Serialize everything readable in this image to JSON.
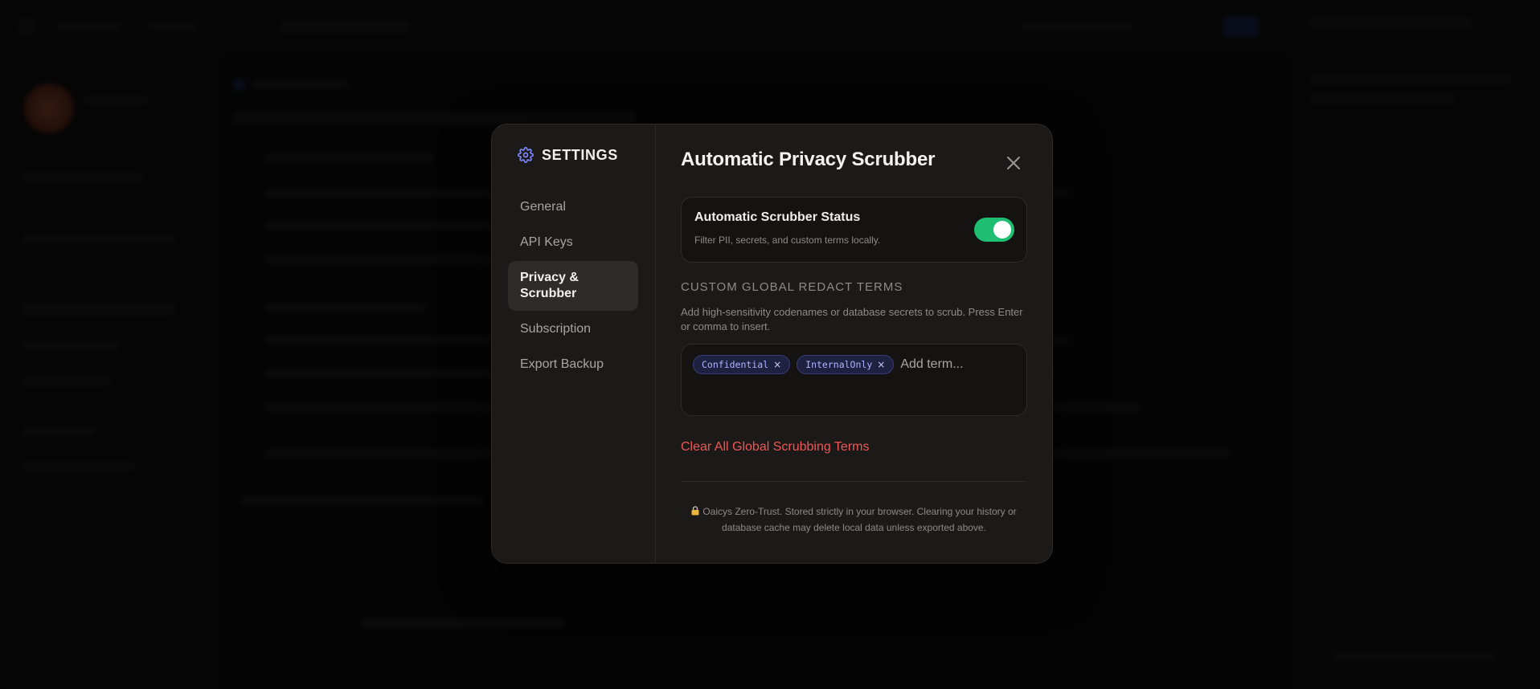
{
  "settings": {
    "title": "SETTINGS",
    "nav": [
      {
        "label": "General"
      },
      {
        "label": "API Keys"
      },
      {
        "label": "Privacy & Scrubber"
      },
      {
        "label": "Subscription"
      },
      {
        "label": "Export Backup"
      }
    ],
    "active_nav": "Privacy & Scrubber"
  },
  "panel": {
    "title": "Automatic Privacy Scrubber",
    "status": {
      "title": "Automatic Scrubber Status",
      "subtitle": "Filter PII, secrets, and custom terms locally.",
      "enabled": true
    },
    "redact": {
      "label": "CUSTOM GLOBAL REDACT TERMS",
      "description": "Add high-sensitivity codenames or database secrets to scrub. Press Enter or comma to insert.",
      "terms": [
        "Confidential",
        "InternalOnly"
      ],
      "remove_symbol": "×",
      "input_placeholder": "Add term..."
    },
    "clear_label": "Clear All Global Scrubbing Terms",
    "footer": "Oaicys Zero-Trust. Stored strictly in your browser. Clearing your history or database cache may delete local data unless exported above."
  },
  "colors": {
    "accent": "#7f86ff",
    "toggle_on": "#1fbf73",
    "danger": "#f05656",
    "chip_bg": "#1f2140"
  },
  "icons": {
    "settings": "gear-icon",
    "close": "close-icon",
    "footer": "lock-icon"
  }
}
